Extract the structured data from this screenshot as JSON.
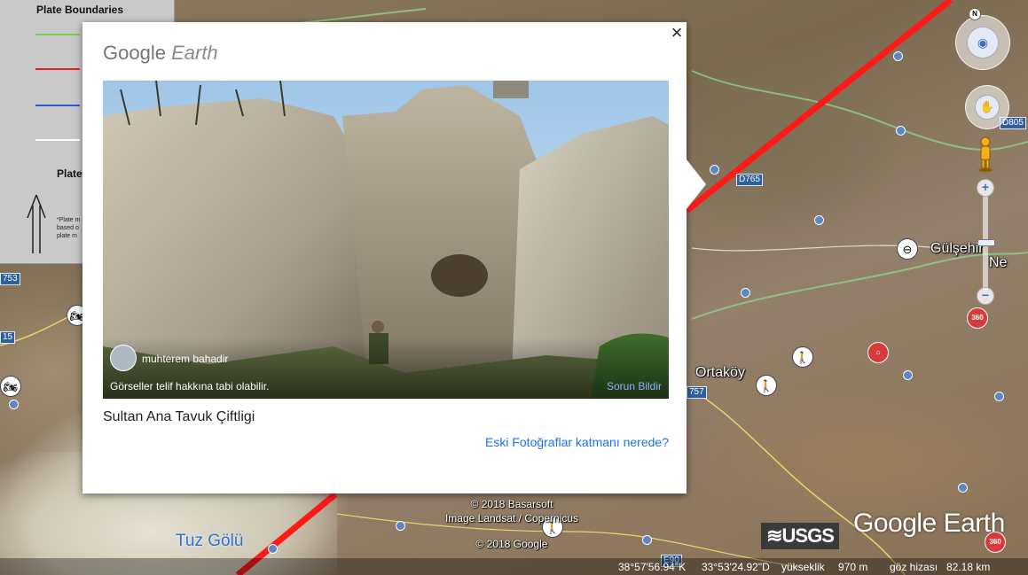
{
  "legend": {
    "title": "Plate Boundaries",
    "swatch_colors": [
      "#6fd24a",
      "#e62020",
      "#2b5bd6",
      "#ffffff"
    ],
    "subtitle": "Plate",
    "note_lines": [
      "*Plate m",
      "based o",
      "plate m"
    ]
  },
  "places": {
    "gulsehir": "Gülşehir",
    "ortakoy": "Ortaköy",
    "tuz_golu": "Tuz Gölü",
    "ne_partial": "Ne"
  },
  "roads": {
    "r1": "753",
    "r2": "15",
    "r3": "D765",
    "r4": "D805",
    "r5": "757",
    "r6": "E90"
  },
  "badges": {
    "label_360": "360"
  },
  "copyright": {
    "line1": "© 2018 Basarsoft",
    "line2": "Image Landsat / Copernicus",
    "line3": "© 2018 Google"
  },
  "brand": {
    "usgs": "≋USGS",
    "google_earth": "Google Earth"
  },
  "status": {
    "lat": "38°57'56.94\"K",
    "lon": "33°53'24.92\"D",
    "elev_label": "yükseklik",
    "elev_value": "970 m",
    "eye_label": "göz hizası",
    "eye_value": "82.18 km"
  },
  "popup": {
    "close_glyph": "×",
    "logo_google": "Google",
    "logo_earth": "Earth",
    "author": "muhterem bahadir",
    "copyright_note": "Görseller telif hakkına tabi olabilir.",
    "report_link": "Sorun Bildir",
    "title": "Sultan Ana Tavuk Çiftligi",
    "help_link": "Eski Fotoğraflar katmanı nerede?"
  },
  "colors": {
    "plate_boundary": "#ff1a1a",
    "road_blue": "#2f5f9e",
    "link_blue": "#1a73e8"
  },
  "icons": {
    "compass": "compass-icon",
    "pan": "hand-icon",
    "pegman": "pegman-icon",
    "hiker": "hiker-icon",
    "pin": "location-pin-icon"
  }
}
